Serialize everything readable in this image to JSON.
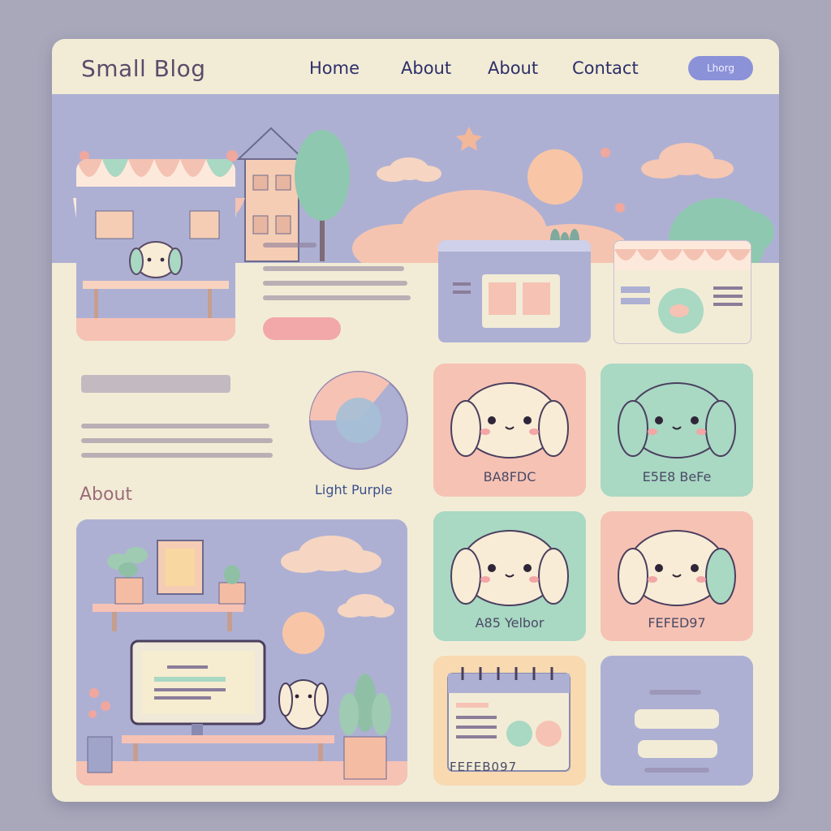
{
  "brand": {
    "title": "Small Blog"
  },
  "nav": {
    "links": [
      "Home",
      "About",
      "About",
      "Contact"
    ],
    "button_label": "Lhorg"
  },
  "sections": {
    "about_heading": "About"
  },
  "swatches": {
    "wheel_label": "Light Purple",
    "cards": [
      {
        "label": "BA8FDC",
        "color": "#f6c2b4"
      },
      {
        "label": "E5E8 BeFe",
        "color": "#a9d8c3"
      },
      {
        "label": "A85 Yelbor",
        "color": "#a9d8c3"
      },
      {
        "label": "FEFED97",
        "color": "#f6c2b4"
      }
    ],
    "calendar_label": "FEFEB097"
  },
  "colors": {
    "page_bg": "#a9a8bb",
    "frame_bg": "#f2ecd6",
    "lavender": "#aeb0d3",
    "peach": "#f6c2b4",
    "mint": "#a9d8c3",
    "accent_button": "#8b92d8",
    "cta_pink": "#f2a8a8"
  }
}
